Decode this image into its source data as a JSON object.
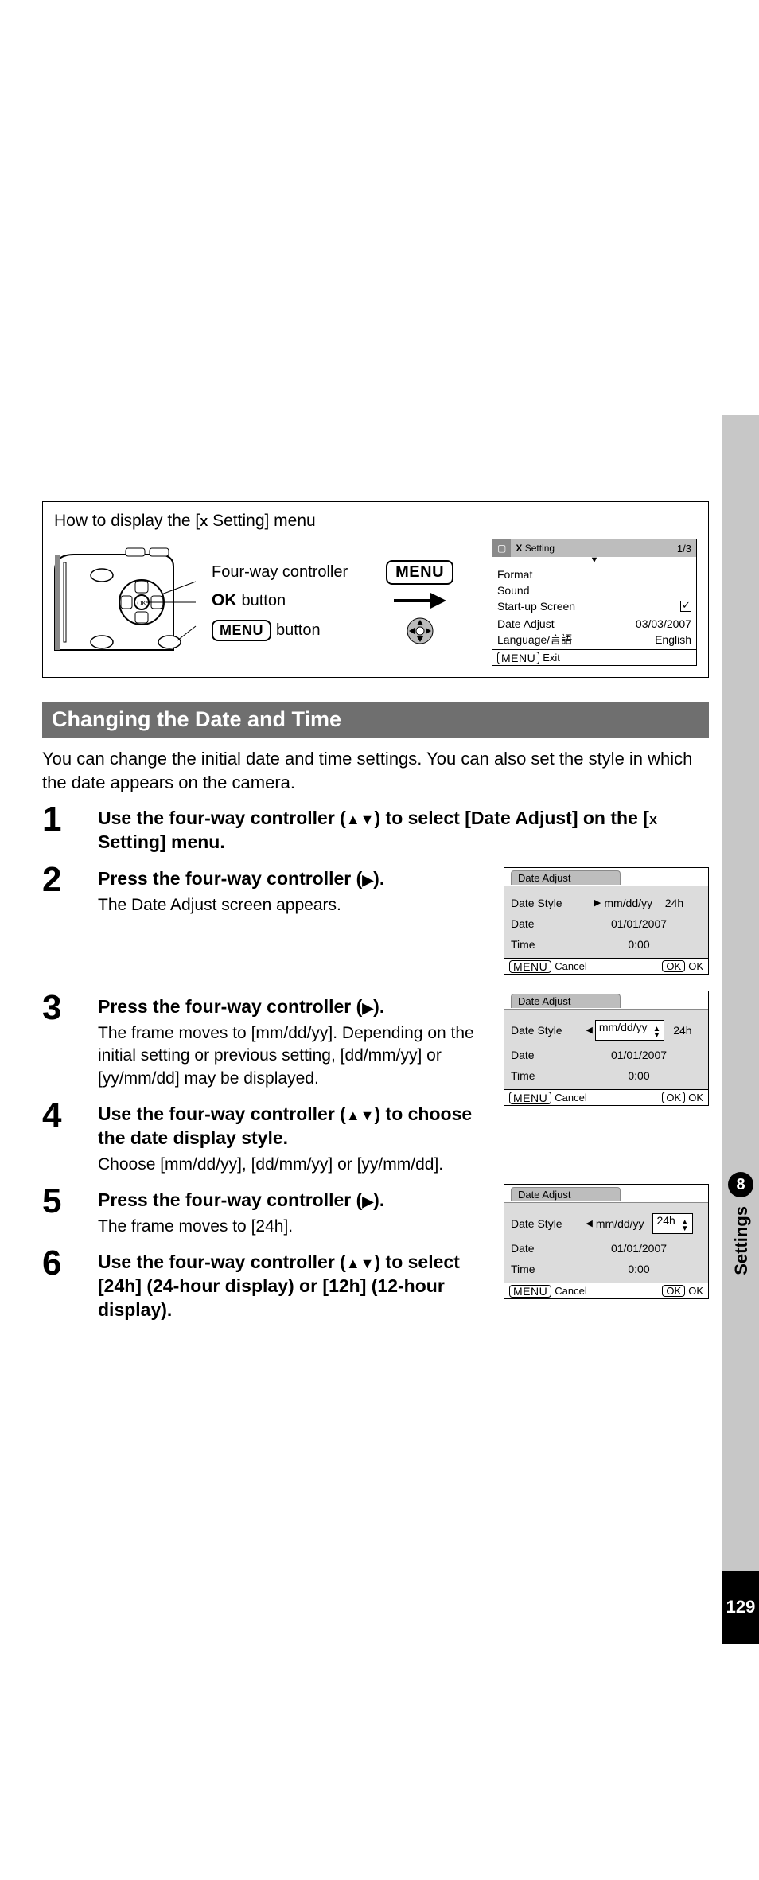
{
  "side": {
    "chapter_num": "8",
    "chapter_label": "Settings",
    "page_num": "129"
  },
  "howbox": {
    "title_prefix": "How to display the [",
    "title_suffix": " Setting] menu",
    "callouts": {
      "fourway": "Four-way controller",
      "ok_button_suffix": " button",
      "menu_button_suffix": " button"
    },
    "menu_badge": "MENU",
    "ok_label": "OK",
    "lcd": {
      "title": "Setting",
      "page": "1/3",
      "rows": {
        "format": "Format",
        "sound": "Sound",
        "startup": "Start-up Screen",
        "date_adjust_l": "Date Adjust",
        "date_adjust_r": "03/03/2007",
        "language_l": "Language/言語",
        "language_r": "English"
      },
      "footer_exit": "Exit"
    }
  },
  "section_title": "Changing the Date and Time",
  "intro": "You can change the initial date and time settings. You can also set the style in which the date appears on the camera.",
  "steps": {
    "s1": {
      "n": "1",
      "instr_a": "Use the four-way controller (",
      "instr_b": ") to select [Date Adjust] on the [",
      "instr_c": " Setting] menu."
    },
    "s2": {
      "n": "2",
      "instr_a": "Press the four-way controller (",
      "instr_b": ").",
      "sub": "The Date Adjust screen appears."
    },
    "s3": {
      "n": "3",
      "instr_a": "Press the four-way controller (",
      "instr_b": ").",
      "sub": "The frame moves to [mm/dd/yy]. Depending on the initial setting or previous setting, [dd/mm/yy] or [yy/mm/dd] may be displayed."
    },
    "s4": {
      "n": "4",
      "instr_a": "Use the four-way controller (",
      "instr_b": ") to choose the date display style.",
      "sub": "Choose [mm/dd/yy], [dd/mm/yy] or [yy/mm/dd]."
    },
    "s5": {
      "n": "5",
      "instr_a": "Press the four-way controller (",
      "instr_b": ").",
      "sub": "The frame moves to [24h]."
    },
    "s6": {
      "n": "6",
      "instr_a": "Use the four-way controller (",
      "instr_b": ") to select [24h] (24-hour display) or [12h] (12-hour display)."
    }
  },
  "da_lcd": {
    "title": "Date Adjust",
    "labels": {
      "style": "Date Style",
      "date": "Date",
      "time": "Time"
    },
    "style_val": "mm/dd/yy",
    "style_24": "24h",
    "date_val": "01/01/2007",
    "time_val": "0:00",
    "footer": {
      "cancel": "Cancel",
      "ok": "OK",
      "menu": "MENU",
      "okbadge": "OK"
    }
  },
  "glyphs": {
    "up": "▲",
    "down": "▼",
    "right": "▶",
    "left": "◀",
    "tools": "🔧"
  }
}
